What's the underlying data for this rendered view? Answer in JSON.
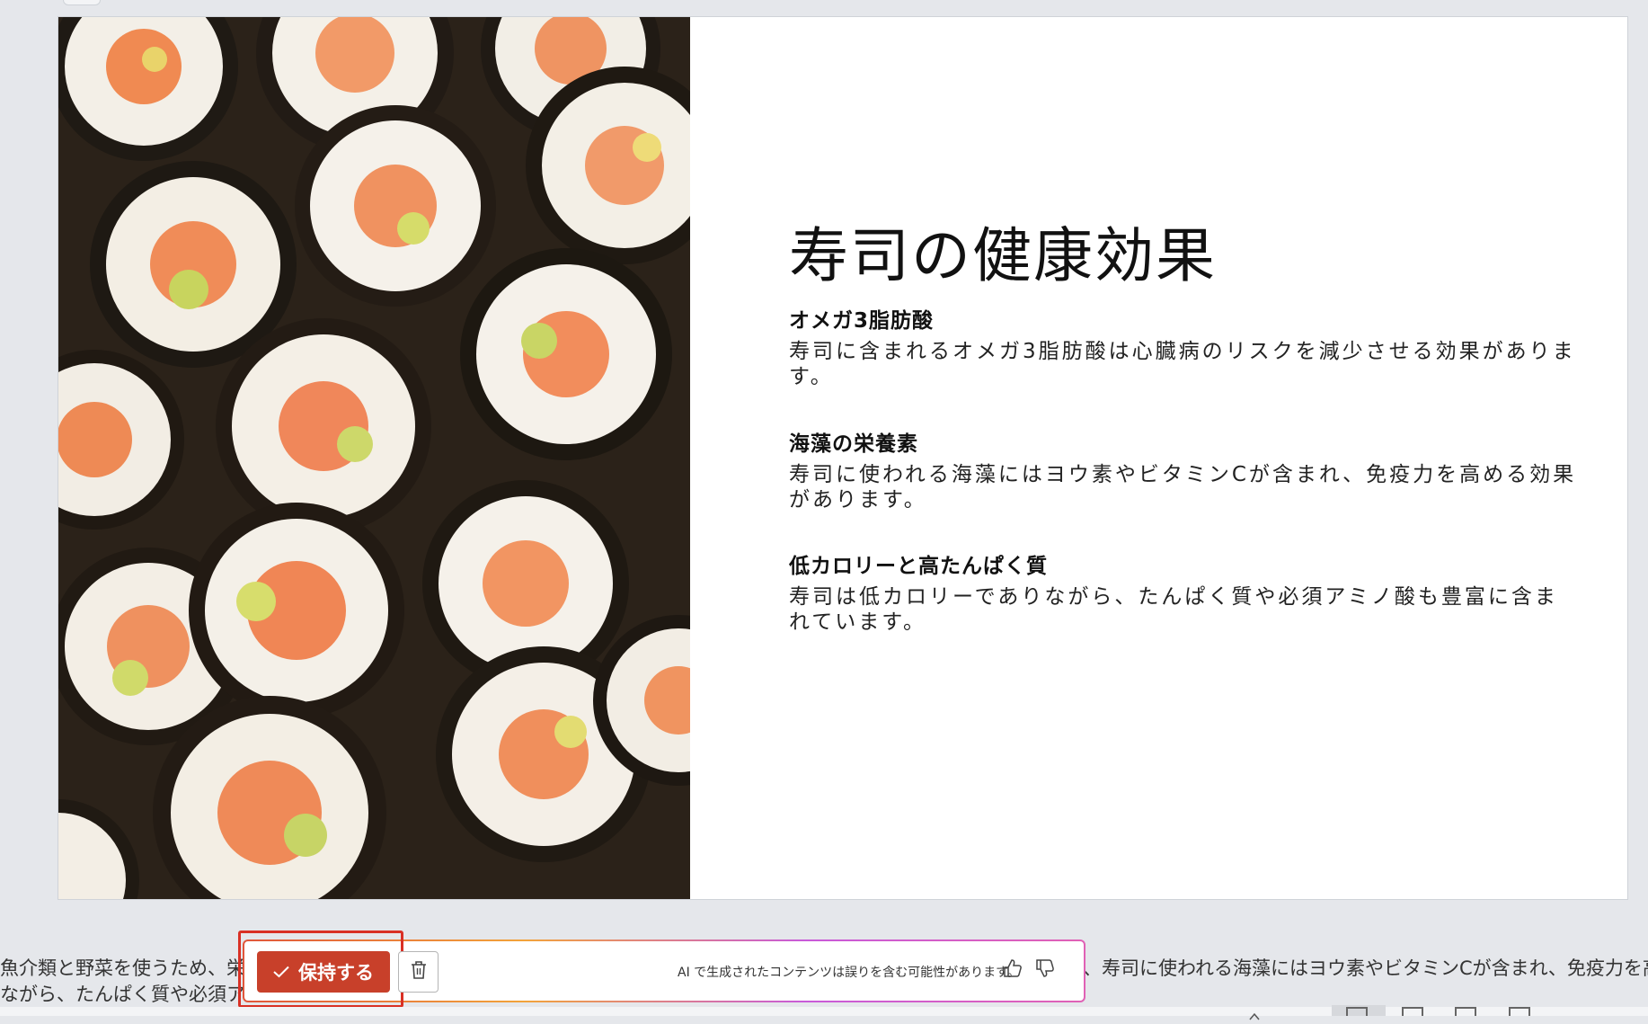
{
  "slide": {
    "title": "寿司の健康効果",
    "sections": [
      {
        "heading": "オメガ3脂肪酸",
        "body": "寿司に含まれるオメガ3脂肪酸は心臓病のリスクを減少させる効果があります。"
      },
      {
        "heading": "海藻の栄養素",
        "body": "寿司に使われる海藻にはヨウ素やビタミンCが含まれ、免疫力を高める効果があります。"
      },
      {
        "heading": "低カロリーと高たんぱく質",
        "body": "寿司は低カロリーでありながら、たんぱく質や必須アミノ酸も豊富に含まれています。"
      }
    ]
  },
  "background_text": {
    "left_line1": "魚介類と野菜を使うため、栄養",
    "left_line2": "ながら、たんぱく質や必須アミノ酸",
    "right_line1": "、寿司に使われる海藻にはヨウ素やビタミンCが含まれ、免疫力を高める効"
  },
  "ai_bar": {
    "keep_label": "保持する",
    "disclaimer": "AI で生成されたコンテンツは誤りを含む可能性があります。"
  },
  "colors": {
    "keep_button": "#c8402a",
    "highlight_outline": "#d93025"
  },
  "icons": {
    "keep": "checkmark-icon",
    "discard": "trash-icon",
    "like": "thumbs-up-icon",
    "dislike": "thumbs-down-icon"
  }
}
